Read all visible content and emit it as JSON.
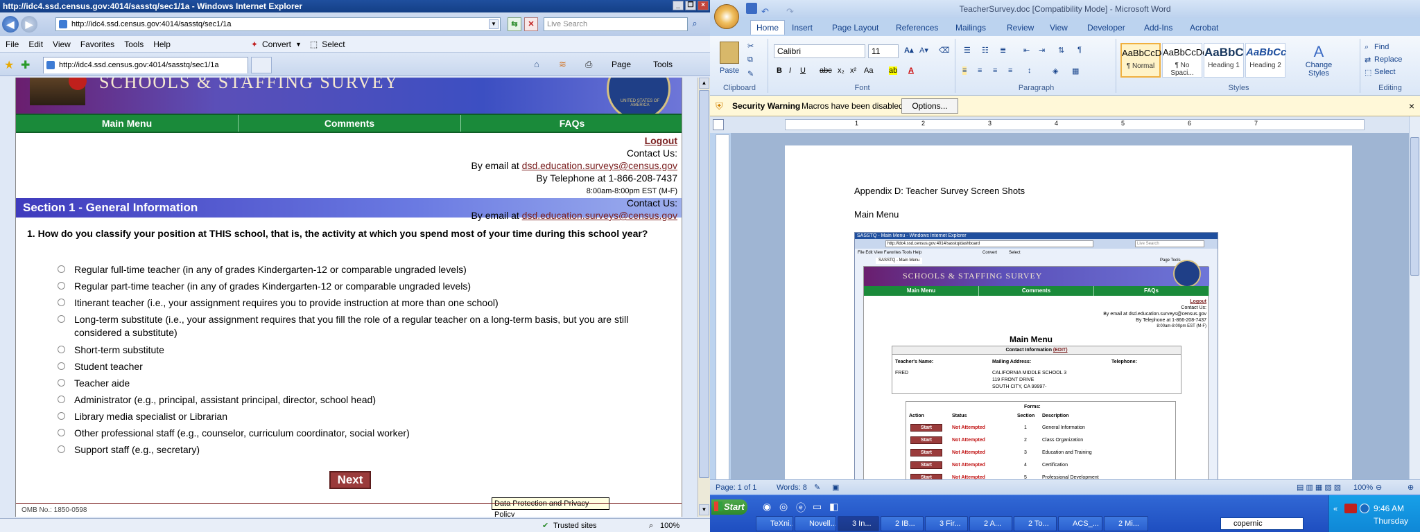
{
  "ie": {
    "title": "http://idc4.ssd.census.gov:4014/sasstq/sec1/1a - Windows Internet Explorer",
    "address": "http://idc4.ssd.census.gov:4014/sasstq/sec1/1a",
    "search_placeholder": "Live Search",
    "menu": [
      "File",
      "Edit",
      "View",
      "Favorites",
      "Tools",
      "Help"
    ],
    "convert_label": "Convert",
    "select_label": "Select",
    "tab_title": "http://idc4.ssd.census.gov:4014/sasstq/sec1/1a",
    "toolbar": {
      "page": "Page",
      "tools": "Tools"
    },
    "status": {
      "zone": "Trusted sites",
      "zoom": "100%"
    }
  },
  "survey": {
    "banner_text": "SCHOOLS & STAFFING SURVEY",
    "seal_text": "UNITED STATES OF AMERICA",
    "nav": [
      "Main Menu",
      "Comments",
      "FAQs"
    ],
    "logout": "Logout",
    "contact_label": "Contact Us:",
    "email_prefix": "By email at",
    "email": "dsd.education.surveys@census.gov",
    "telephone": "By Telephone at 1-866-208-7437",
    "hours": "8:00am-8:00pm EST (M-F)",
    "section_title": "Section 1 - General Information",
    "contact_overlap_label": "Contact Us:",
    "question": "1. How do you classify your position at THIS school, that is, the activity at which you spend most of your time during this school year?",
    "options": [
      "Regular full-time teacher (in any of grades Kindergarten-12 or comparable ungraded levels)",
      "Regular part-time teacher (in any of grades Kindergarten-12 or comparable ungraded levels)",
      "Itinerant teacher (i.e., your assignment requires you to provide instruction at more than one school)",
      "Long-term substitute (i.e., your assignment requires that you fill the role of a regular teacher on a long-term basis, but you are still considered a substitute)",
      "Short-term substitute",
      "Student teacher",
      "Teacher aide",
      "Administrator (e.g., principal, assistant principal, director, school head)",
      "Library media specialist or Librarian",
      "Other professional staff (e.g., counselor, curriculum coordinator, social worker)",
      "Support staff (e.g., secretary)"
    ],
    "next_label": "Next",
    "tooltip": "Data Protection and Privacy Policy",
    "omb": "OMB No.: 1850-0598"
  },
  "word": {
    "title": "TeacherSurvey.doc [Compatibility Mode] - Microsoft Word",
    "tabs": [
      "Home",
      "Insert",
      "Page Layout",
      "References",
      "Mailings",
      "Review",
      "View",
      "Developer",
      "Add-Ins",
      "Acrobat"
    ],
    "paste": "Paste",
    "font_name": "Calibri",
    "font_size": "11",
    "groups": {
      "clipboard": "Clipboard",
      "font": "Font",
      "paragraph": "Paragraph",
      "styles": "Styles",
      "editing": "Editing"
    },
    "styles": [
      {
        "preview": "AaBbCcDc",
        "name": "¶ Normal"
      },
      {
        "preview": "AaBbCcDc",
        "name": "¶ No Spaci..."
      },
      {
        "preview": "AaBbC",
        "name": "Heading 1"
      },
      {
        "preview": "AaBbCc",
        "name": "Heading 2"
      }
    ],
    "change_styles": "Change Styles",
    "editing": {
      "find": "Find",
      "replace": "Replace",
      "select": "Select"
    },
    "security_label": "Security Warning",
    "security_text": "Macros have been disabled.",
    "options_button": "Options...",
    "ruler_marks": [
      "1",
      "2",
      "3",
      "4",
      "5",
      "6",
      "7"
    ],
    "doc": {
      "appendix": "Appendix D: Teacher Survey Screen Shots",
      "main_menu": "Main Menu"
    },
    "status": {
      "page": "Page: 1 of 1",
      "words": "Words: 8",
      "zoom": "100%"
    }
  },
  "embedded": {
    "title": "SASSTQ - Main Menu - Windows Internet Explorer",
    "address": "http://idc4.ssd.census.gov:4014/sasstq/dashboard",
    "search": "Live Search",
    "menu": "File  Edit  View  Favorites  Tools  Help",
    "convert": "Convert",
    "select": "Select",
    "tab": "SASSTQ - Main Menu",
    "page_tools": "Page  Tools",
    "banner": "SCHOOLS & STAFFING SURVEY",
    "nav": [
      "Main Menu",
      "Comments",
      "FAQs"
    ],
    "logout": "Logout",
    "contact": "Contact Us:",
    "email_line": "By email at dsd.education.surveys@census.gov",
    "telephone": "By Telephone at 1-866-208-7437",
    "hours": "8:00am-8:00pm EST (M-F)",
    "heading": "Main Menu",
    "contact_info": "Contact Information",
    "edit": "(EDIT)",
    "teacher_name_label": "Teacher's Name:",
    "mailing_label": "Mailing Address:",
    "telephone_label": "Telephone:",
    "teacher_name": "FRED",
    "address_lines": [
      "CALIFORNIA MIDDLE SCHOOL 3",
      "119 FRONT DRIVE",
      "SOUTH CITY, CA 99997-"
    ],
    "forms_label": "Forms:",
    "columns": [
      "Action",
      "Status",
      "Section",
      "Description"
    ],
    "rows": [
      {
        "action": "Start",
        "status": "Not Attempted",
        "section": "1",
        "description": "General Information"
      },
      {
        "action": "Start",
        "status": "Not Attempted",
        "section": "2",
        "description": "Class Organization"
      },
      {
        "action": "Start",
        "status": "Not Attempted",
        "section": "3",
        "description": "Education and Training"
      },
      {
        "action": "Start",
        "status": "Not Attempted",
        "section": "4",
        "description": "Certification"
      },
      {
        "action": "Start",
        "status": "Not Attempted",
        "section": "5",
        "description": "Professional Development"
      }
    ]
  },
  "taskbar": {
    "start": "Start",
    "tasks": [
      "TeXni...",
      "Novell...",
      "3 In...",
      "2 IB...",
      "3 Fir...",
      "2 A...",
      "2 To...",
      "ACS_...",
      "2 Mi..."
    ],
    "search_text": "copernic",
    "time": "9:46 AM",
    "day": "Thursday"
  }
}
